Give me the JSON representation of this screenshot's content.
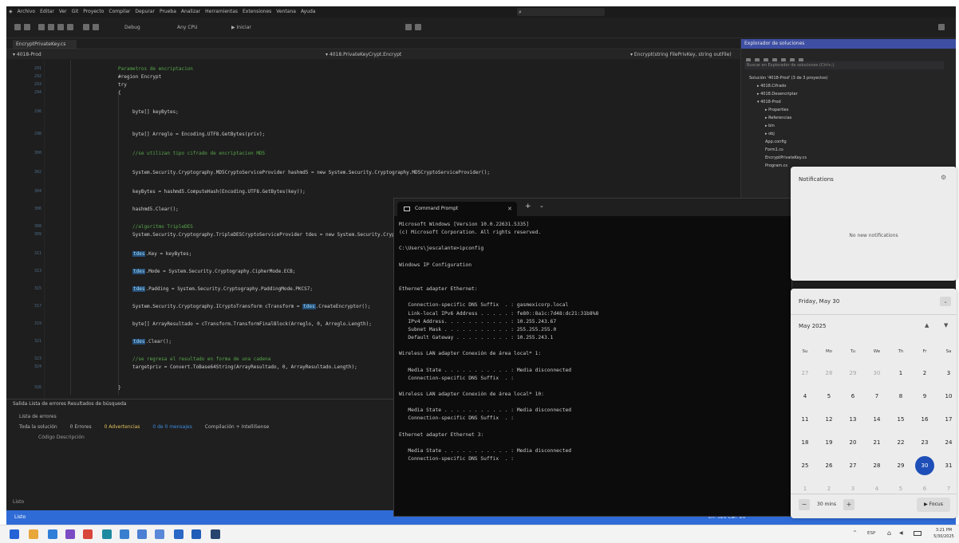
{
  "vs": {
    "menu": [
      "Archivo",
      "Editar",
      "Ver",
      "Git",
      "Proyecto",
      "Compilar",
      "Depurar",
      "Prueba",
      "Analizar",
      "Herramientas",
      "Extensiones",
      "Ventana",
      "Ayuda"
    ],
    "toolbar": {
      "config": "Debug",
      "platform": "Any CPU",
      "start": "▶ Iniciar"
    },
    "active_tab": "EncryptPrivateKey.cs",
    "navbar": {
      "left": "▾ 4018-Prod",
      "mid": "▾ 4018.PrivateKeyCrypt.Encrypt",
      "right": "▾ Encrypt(string FilePrivKey, string outFile)"
    },
    "code_lines": [
      {
        "n": "291",
        "i": 1,
        "parts": [
          [
            "c-com",
            "Parametros de encriptacion"
          ]
        ]
      },
      {
        "n": "292",
        "i": 1,
        "parts": [
          [
            "c-txt",
            "#region Encrypt"
          ]
        ]
      },
      {
        "n": "293",
        "i": 1,
        "parts": [
          [
            "c-txt",
            "try"
          ]
        ]
      },
      {
        "n": "294",
        "i": 1,
        "parts": [
          [
            "c-txt",
            "{"
          ]
        ]
      },
      {
        "n": "296",
        "i": 2,
        "parts": [
          [
            "c-txt",
            "byte[] keyBytes;"
          ]
        ]
      },
      {
        "n": "298",
        "i": 2,
        "parts": [
          [
            "c-txt",
            "byte[] Arreglo = Encoding.UTF8.GetBytes(priv);"
          ]
        ]
      },
      {
        "n": "300",
        "i": 2,
        "parts": [
          [
            "c-com",
            "//se utilizan tipo cifrado de encriptacion MD5"
          ]
        ]
      },
      {
        "n": "302",
        "i": 2,
        "parts": [
          [
            "c-txt",
            "System.Security.Cryptography.MD5CryptoServiceProvider hashmd5 = new System.Security.Cryptography.MD5CryptoServiceProvider();"
          ]
        ]
      },
      {
        "n": "304",
        "i": 2,
        "parts": [
          [
            "c-txt",
            "keyBytes = hashmd5.ComputeHash(Encoding.UTF8.GetBytes(key));"
          ]
        ]
      },
      {
        "n": "306",
        "i": 2,
        "parts": [
          [
            "c-txt",
            "hashmd5.Clear();"
          ]
        ]
      },
      {
        "n": "308",
        "i": 2,
        "parts": [
          [
            "c-com",
            "//algoritmo TripleDES"
          ]
        ]
      },
      {
        "n": "309",
        "i": 2,
        "parts": [
          [
            "c-txt",
            "System.Security.Cryptography.TripleDESCryptoServiceProvider tdes = new System.Security.Cryptography.TripleDESCryptoServiceProvider();"
          ]
        ]
      },
      {
        "n": "311",
        "i": 2,
        "parts": [
          [
            "c-kw",
            "tdes"
          ],
          [
            "c-txt",
            ".Key = keyBytes;"
          ]
        ]
      },
      {
        "n": "313",
        "i": 2,
        "parts": [
          [
            "c-kw",
            "tdes"
          ],
          [
            "c-txt",
            ".Mode = System.Security.Cryptography.CipherMode.ECB;"
          ]
        ]
      },
      {
        "n": "315",
        "i": 2,
        "parts": [
          [
            "c-kw",
            "tdes"
          ],
          [
            "c-txt",
            ".Padding = System.Security.Cryptography.PaddingMode.PKCS7;"
          ]
        ]
      },
      {
        "n": "317",
        "i": 2,
        "parts": [
          [
            "c-txt",
            "System.Security.Cryptography.ICryptoTransform cTransform = "
          ],
          [
            "c-kw",
            "tdes"
          ],
          [
            "c-txt",
            ".CreateEncryptor();"
          ]
        ]
      },
      {
        "n": "319",
        "i": 2,
        "parts": [
          [
            "c-txt",
            "byte[] ArrayResultado = cTransform.TransformFinalBlock(Arreglo, 0, Arreglo.Length);"
          ]
        ]
      },
      {
        "n": "321",
        "i": 2,
        "parts": [
          [
            "c-kw",
            "tdes"
          ],
          [
            "c-txt",
            ".Clear();"
          ]
        ]
      },
      {
        "n": "323",
        "i": 2,
        "parts": [
          [
            "c-com",
            "//se regresa el resultado en forma de una cadena"
          ]
        ]
      },
      {
        "n": "324",
        "i": 2,
        "parts": [
          [
            "c-txt",
            "targetpriv = Convert.ToBase64String(ArrayResultado, 0, ArrayResultado.Length);"
          ]
        ]
      },
      {
        "n": "326",
        "i": 1,
        "parts": [
          [
            "c-txt",
            "}"
          ]
        ]
      }
    ],
    "bottom": {
      "tabs": "Salida    Lista de errores    Resultados de búsqueda",
      "title": "Lista de errores",
      "filter": "Toda la solución",
      "errors": "0 Errores",
      "warnings": "0 Advertencias",
      "messages": "0 de 0 mensajes",
      "build": "Compilación + IntelliSense",
      "columns": "Código    Descripción",
      "footer": "Listo"
    },
    "status_left": "Listo",
    "status_mid": "Ln: 326  Car: 26"
  },
  "solution_explorer": {
    "title": "Explorador de soluciones",
    "search_placeholder": "Buscar en Explorador de soluciones (Ctrl+;)",
    "nodes": [
      {
        "i": 0,
        "t": "Solución '4018-Prod' (3 de 3 proyectos)"
      },
      {
        "i": 1,
        "t": "▸ 4018.Cifrado"
      },
      {
        "i": 1,
        "t": "▸ 4018.Desencriptar"
      },
      {
        "i": 1,
        "t": "▾ 4018-Prod"
      },
      {
        "i": 2,
        "t": "▸ Properties"
      },
      {
        "i": 2,
        "t": "▸ Referencias"
      },
      {
        "i": 2,
        "t": "▸ bin"
      },
      {
        "i": 2,
        "t": "▸ obj"
      },
      {
        "i": 2,
        "t": "App.config"
      },
      {
        "i": 2,
        "t": "Form1.cs"
      },
      {
        "i": 2,
        "t": "EncryptPrivateKey.cs"
      },
      {
        "i": 2,
        "t": "Program.cs"
      }
    ]
  },
  "cmd": {
    "tab_title": "Command Prompt",
    "lines": [
      "Microsoft Windows [Version 10.0.22631.5335]",
      "(c) Microsoft Corporation. All rights reserved.",
      "",
      "C:\\Users\\jescalante>ipconfig",
      "",
      "Windows IP Configuration",
      "",
      "",
      "Ethernet adapter Ethernet:",
      "",
      "   Connection-specific DNS Suffix  . : gasmexicorp.local",
      "   Link-local IPv6 Address . . . . . : fe80::8a1c:7d48:dc21:31b8%8",
      "   IPv4 Address. . . . . . . . . . . : 10.255.243.67",
      "   Subnet Mask . . . . . . . . . . . : 255.255.255.0",
      "   Default Gateway . . . . . . . . . : 10.255.243.1",
      "",
      "Wireless LAN adapter Conexión de área local* 1:",
      "",
      "   Media State . . . . . . . . . . . : Media disconnected",
      "   Connection-specific DNS Suffix  . :",
      "",
      "Wireless LAN adapter Conexión de área local* 10:",
      "",
      "   Media State . . . . . . . . . . . : Media disconnected",
      "   Connection-specific DNS Suffix  . :",
      "",
      "Ethernet adapter Ethernet 3:",
      "",
      "   Media State . . . . . . . . . . . : Media disconnected",
      "   Connection-specific DNS Suffix  . :"
    ]
  },
  "notifications": {
    "title": "Notifications",
    "empty": "No new notifications"
  },
  "calendar": {
    "date_label": "Friday, May 30",
    "month_label": "May 2025",
    "weekdays": [
      "Su",
      "Mo",
      "Tu",
      "We",
      "Th",
      "Fr",
      "Sa"
    ],
    "weeks": [
      [
        {
          "d": "27",
          "o": true
        },
        {
          "d": "28",
          "o": true
        },
        {
          "d": "29",
          "o": true
        },
        {
          "d": "30",
          "o": true
        },
        {
          "d": "1"
        },
        {
          "d": "2"
        },
        {
          "d": "3"
        }
      ],
      [
        {
          "d": "4"
        },
        {
          "d": "5"
        },
        {
          "d": "6"
        },
        {
          "d": "7"
        },
        {
          "d": "8"
        },
        {
          "d": "9"
        },
        {
          "d": "10"
        }
      ],
      [
        {
          "d": "11"
        },
        {
          "d": "12"
        },
        {
          "d": "13"
        },
        {
          "d": "14"
        },
        {
          "d": "15"
        },
        {
          "d": "16"
        },
        {
          "d": "17"
        }
      ],
      [
        {
          "d": "18"
        },
        {
          "d": "19"
        },
        {
          "d": "20"
        },
        {
          "d": "21"
        },
        {
          "d": "22"
        },
        {
          "d": "23"
        },
        {
          "d": "24"
        }
      ],
      [
        {
          "d": "25"
        },
        {
          "d": "26"
        },
        {
          "d": "27"
        },
        {
          "d": "28"
        },
        {
          "d": "29"
        },
        {
          "d": "30",
          "t": true
        },
        {
          "d": "31"
        }
      ],
      [
        {
          "d": "1",
          "o": true
        },
        {
          "d": "2",
          "o": true
        },
        {
          "d": "3",
          "o": true
        },
        {
          "d": "4",
          "o": true
        },
        {
          "d": "5",
          "o": true
        },
        {
          "d": "6",
          "o": true
        },
        {
          "d": "7",
          "o": true
        }
      ]
    ],
    "focus_time": "30 mins",
    "focus_label": "▶ Focus"
  },
  "taskbar": {
    "apps": [
      {
        "name": "start-icon",
        "color": "#2563d6"
      },
      {
        "name": "search-app-icon",
        "color": "#e8a73b"
      },
      {
        "name": "vs-code-icon",
        "color": "#2f7fd8"
      },
      {
        "name": "visual-studio-icon",
        "color": "#7b4bc4"
      },
      {
        "name": "chrome-icon",
        "color": "#d8453a"
      },
      {
        "name": "edge-icon",
        "color": "#1d8a9f"
      },
      {
        "name": "onedrive-icon",
        "color": "#3a7fcf"
      },
      {
        "name": "app-icon",
        "color": "#4c7fd3"
      },
      {
        "name": "app2-icon",
        "color": "#5a88d8"
      },
      {
        "name": "app3-icon",
        "color": "#2b67c7"
      },
      {
        "name": "app4-icon",
        "color": "#1f5db8"
      },
      {
        "name": "mail-icon",
        "color": "#27456e"
      }
    ],
    "lang": "ESP",
    "time": "3:21 PM",
    "date": "5/30/2025"
  }
}
